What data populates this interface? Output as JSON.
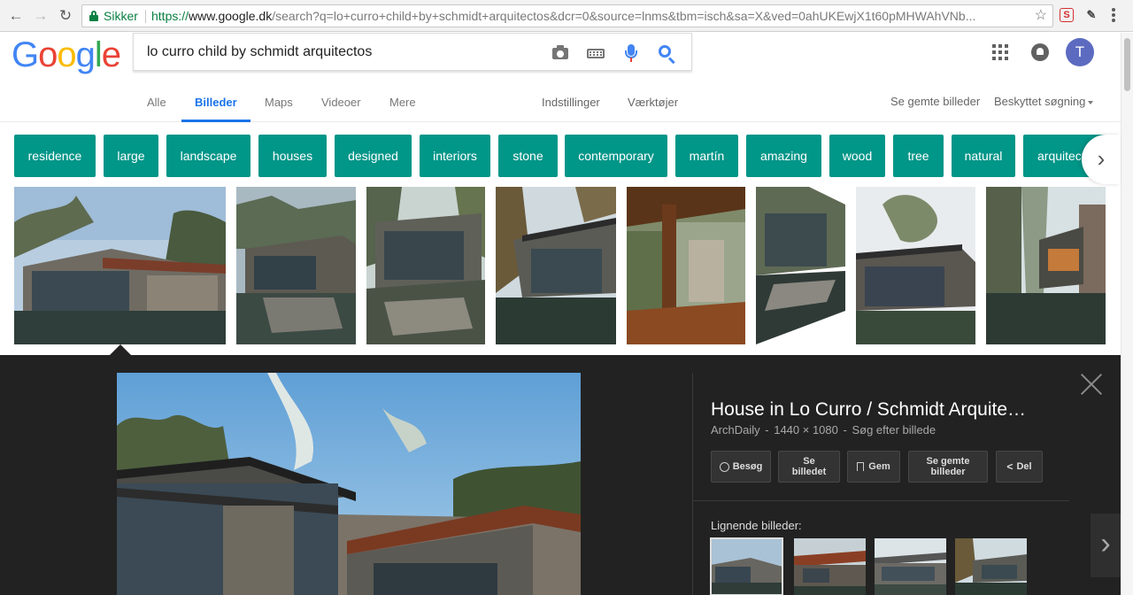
{
  "browser": {
    "secure_label": "Sikker",
    "url_proto": "https://",
    "url_host": "www.google.dk",
    "url_rest": "/search?q=lo+curro+child+by+schmidt+arquitectos&dcr=0&source=lnms&tbm=isch&sa=X&ved=0ahUKEwjX1t60pMHWAhVNb...",
    "ext1_label": "S"
  },
  "search": {
    "query": "lo curro child by schmidt arquitectos"
  },
  "account": {
    "avatar_initial": "T"
  },
  "tabs": [
    {
      "label": "Alle"
    },
    {
      "label": "Billeder"
    },
    {
      "label": "Maps"
    },
    {
      "label": "Videoer"
    },
    {
      "label": "Mere"
    }
  ],
  "tools": {
    "settings": "Indstillinger",
    "tools": "Værktøjer",
    "saved_images": "Se gemte billeder",
    "safe_search": "Beskyttet søgning"
  },
  "chips": [
    "residence",
    "large",
    "landscape",
    "houses",
    "designed",
    "interiors",
    "stone",
    "contemporary",
    "martín",
    "amazing",
    "wood",
    "tree",
    "natural",
    "arquitectos"
  ],
  "panel": {
    "title": "House in Lo Curro / Schmidt Arquite…",
    "source": "ArchDaily",
    "dimensions": "1440 × 1080",
    "search_by_image": "Søg efter billede",
    "meta_sep": "-",
    "actions": {
      "visit": "Besøg",
      "view_line1": "Se",
      "view_line2": "billedet",
      "save": "Gem",
      "saved_line1": "Se gemte",
      "saved_line2": "billeder",
      "share": "Del"
    },
    "similar_label": "Lignende billeder:"
  },
  "colors": {
    "chip": "#009688",
    "accent": "#1a73e8",
    "panel_bg": "#222222",
    "secure_green": "#0b8043"
  }
}
